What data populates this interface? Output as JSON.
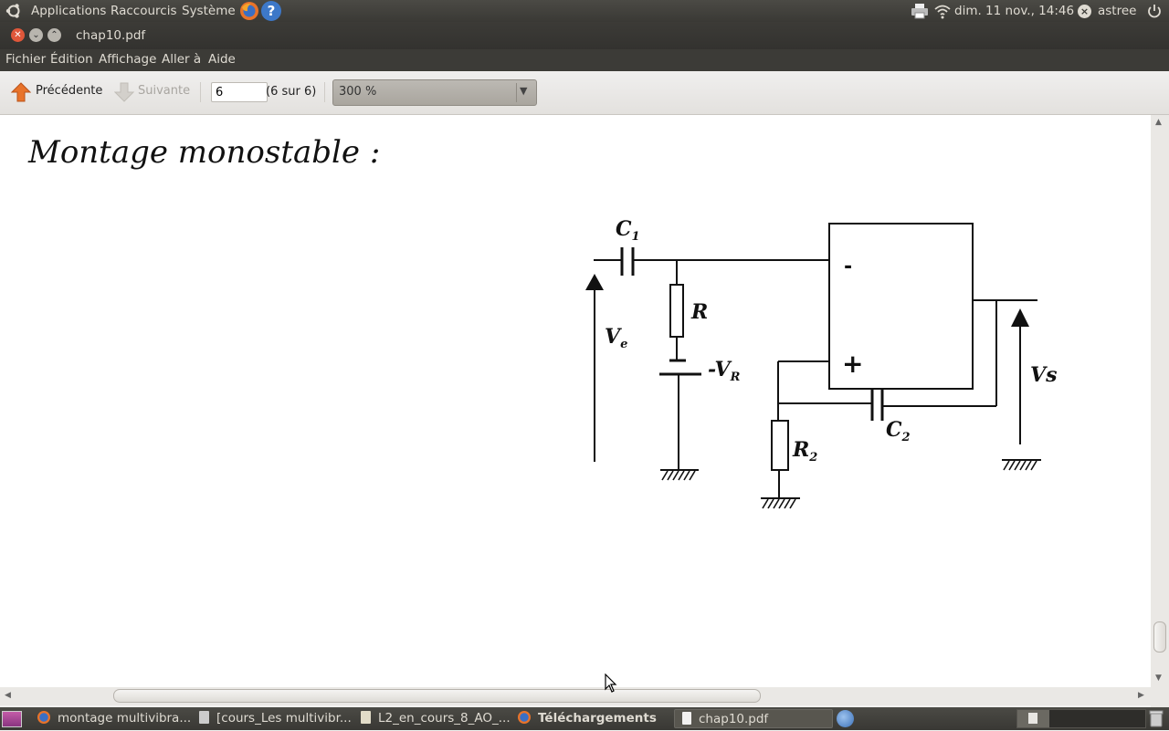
{
  "top_panel": {
    "menus": [
      "Applications",
      "Raccourcis",
      "Système"
    ],
    "clock": "dim. 11 nov., 14:46",
    "user": "astree"
  },
  "window": {
    "title": "chap10.pdf"
  },
  "menubar": [
    "Fichier",
    "Édition",
    "Affichage",
    "Aller à",
    "Aide"
  ],
  "toolbar": {
    "prev_label": "Précédente",
    "next_label": "Suivante",
    "page_value": "6",
    "page_count": "(6 sur 6)",
    "zoom": "300 %"
  },
  "document": {
    "heading": "Montage monostable :",
    "circuit": {
      "c1": "C",
      "c1_sub": "1",
      "r": "R",
      "ve": "V",
      "ve_sub": "e",
      "vr": "-V",
      "vr_sub": "R",
      "minus": "-",
      "plus": "+",
      "c2": "C",
      "c2_sub": "2",
      "r2": "R",
      "r2_sub": "2",
      "vs": "Vs"
    }
  },
  "taskbar": [
    "montage multivibra...",
    "[cours_Les multivibr...",
    "L2_en_cours_8_AO_...",
    "Téléchargements",
    "chap10.pdf"
  ],
  "colors": {
    "panel": "#3c3b37",
    "panel_text": "#dfdbd2",
    "arrow_orange": "#e8732a",
    "toolbar_bg": "#ebe9e6"
  }
}
